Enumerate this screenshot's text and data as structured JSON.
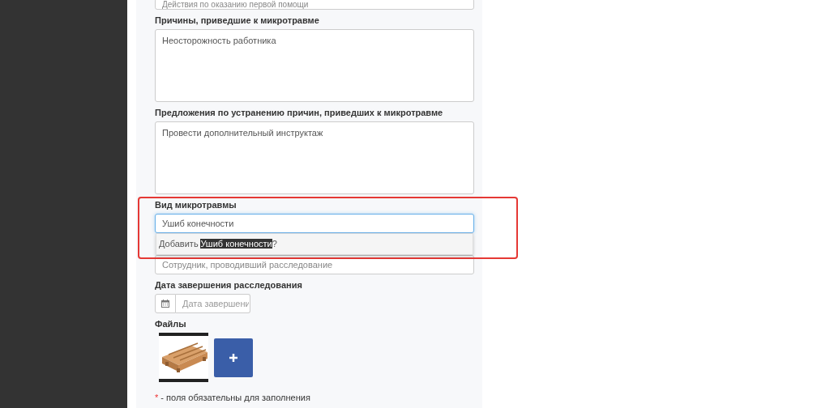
{
  "top_field": {
    "placeholder": "Действия по оказанию первой помощи"
  },
  "fields": [
    {
      "kind": "textarea",
      "label": "Причины, приведшие к микротравме",
      "value": "Неосторожность работника"
    },
    {
      "kind": "textarea",
      "label": "Предложения по устранению причин, приведших к микротравме",
      "value": "Провести дополнительный инструктаж"
    },
    {
      "kind": "autocomplete",
      "label": "Вид микротравмы",
      "value": "Ушиб конечности",
      "focused": true,
      "suggestion": {
        "prefix": "Добавить",
        "term": "Ушиб конечности",
        "suffix": "?"
      }
    },
    {
      "kind": "input",
      "placeholder": "Сотрудник, проводивший расследование"
    },
    {
      "kind": "date",
      "label": "Дата завершения расследования",
      "placeholder": "Дата завершени"
    }
  ],
  "files": {
    "label": "Файлы"
  },
  "footnote": {
    "mark": "*",
    "text": "- поля обязательны для заполнения"
  }
}
